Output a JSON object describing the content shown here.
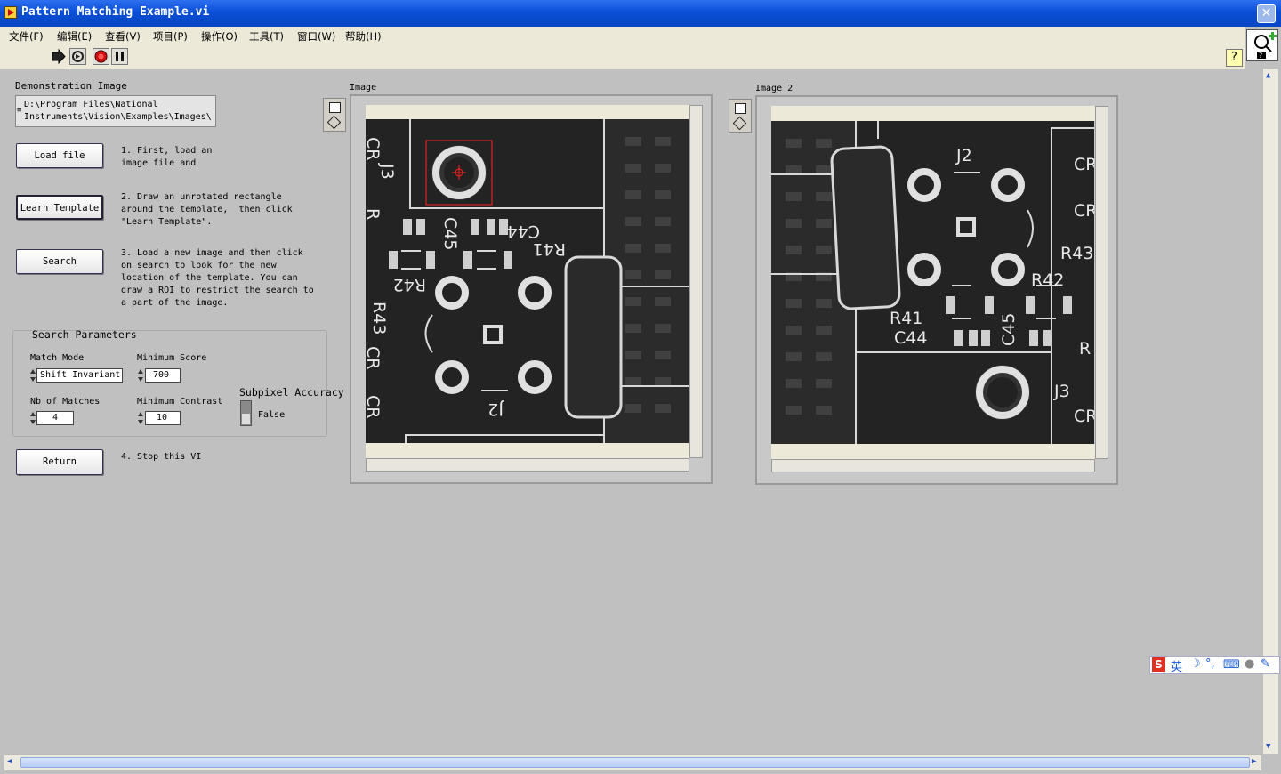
{
  "window": {
    "title": "Pattern Matching Example.vi",
    "close_glyph": "✕"
  },
  "menu": [
    "文件(F)",
    "编辑(E)",
    "查看(V)",
    "项目(P)",
    "操作(O)",
    "工具(T)",
    "窗口(W)",
    "帮助(H)"
  ],
  "toolbar": {
    "help_glyph": "?"
  },
  "panel": {
    "demo_label": "Demonstration Image",
    "path": "D:\\Program Files\\National Instruments\\Vision\\Examples\\Images\\",
    "path_line1": "D:\\Program Files\\National",
    "path_line2": "Instruments\\Vision\\Examples\\Images\\",
    "load_label": "Load file",
    "learn_label": "Learn Template",
    "search_label": "Search",
    "return_label": "Return",
    "step1": "1. First, load an\nimage file and",
    "step2": "2. Draw an unrotated rectangle\naround the template,  then click\n\"Learn Template\".",
    "step3": "3. Load a new image and then click\non search to look for the new\nlocation of the template. You can\ndraw a ROI to restrict the search to\na part of the image.",
    "step4": "4. Stop this VI"
  },
  "search_params": {
    "title": "Search Parameters",
    "match_mode_label": "Match Mode",
    "match_mode_value": "Shift Invariant",
    "min_score_label": "Minimum Score",
    "min_score_value": "700",
    "nb_matches_label": "Nb of Matches",
    "nb_matches_value": "4",
    "min_contrast_label": "Minimum Contrast",
    "min_contrast_value": "10",
    "subpixel_label": "Subpixel Accuracy",
    "subpixel_value": "False"
  },
  "image1": {
    "label": "Image",
    "pcb_labels": [
      "C44",
      "R41",
      "C45",
      "R42",
      "R43",
      "J3",
      "J2",
      "CR",
      "R"
    ]
  },
  "image2": {
    "label": "Image 2",
    "pcb_labels": [
      "J2",
      "CR",
      "R43",
      "R42",
      "R41",
      "C44",
      "C45",
      "J3",
      "R"
    ]
  },
  "ime": {
    "brand": "S",
    "lang": "英"
  },
  "colors": {
    "title_bar": "#0a4fd6",
    "panel_bg": "#c0c0c0",
    "roi": "#ff2020"
  }
}
